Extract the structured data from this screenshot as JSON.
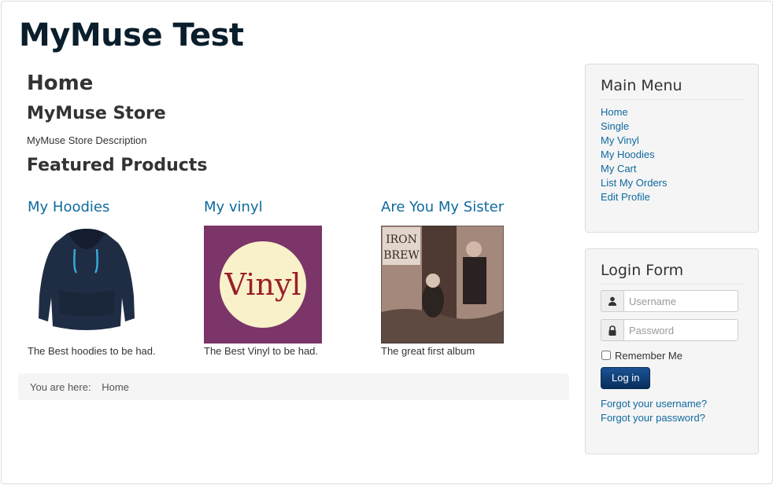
{
  "site": {
    "title": "MyMuse Test"
  },
  "main": {
    "page_heading": "Home",
    "store_heading": "MyMuse Store",
    "store_description": "MyMuse Store Description",
    "featured_heading": "Featured Products",
    "products": [
      {
        "title": "My Hoodies",
        "description": "The Best hoodies to be had.",
        "image_icon": "hoodie-image"
      },
      {
        "title": "My vinyl",
        "description": "The Best Vinyl to be had.",
        "image_icon": "vinyl-image",
        "image_text": "Vinyl"
      },
      {
        "title": "Are You My Sister",
        "description": "The great first album",
        "image_icon": "album-cover-image",
        "image_text_top": "IRON",
        "image_text_mid": "BREW"
      }
    ]
  },
  "breadcrumb": {
    "label": "You are here:",
    "items": [
      "Home"
    ]
  },
  "sidebar": {
    "main_menu": {
      "title": "Main Menu",
      "items": [
        "Home",
        "Single",
        "My Vinyl",
        "My Hoodies",
        "My Cart",
        "List My Orders",
        "Edit Profile"
      ]
    },
    "login_form": {
      "title": "Login Form",
      "username_placeholder": "Username",
      "password_placeholder": "Password",
      "remember_label": "Remember Me",
      "login_button": "Log in",
      "forgot_username": "Forgot your username?",
      "forgot_password": "Forgot your password?"
    }
  },
  "colors": {
    "link": "#0f6a9e",
    "button": "#0a3b74",
    "panel_bg": "#f5f5f5",
    "title": "#0a1e2c"
  }
}
